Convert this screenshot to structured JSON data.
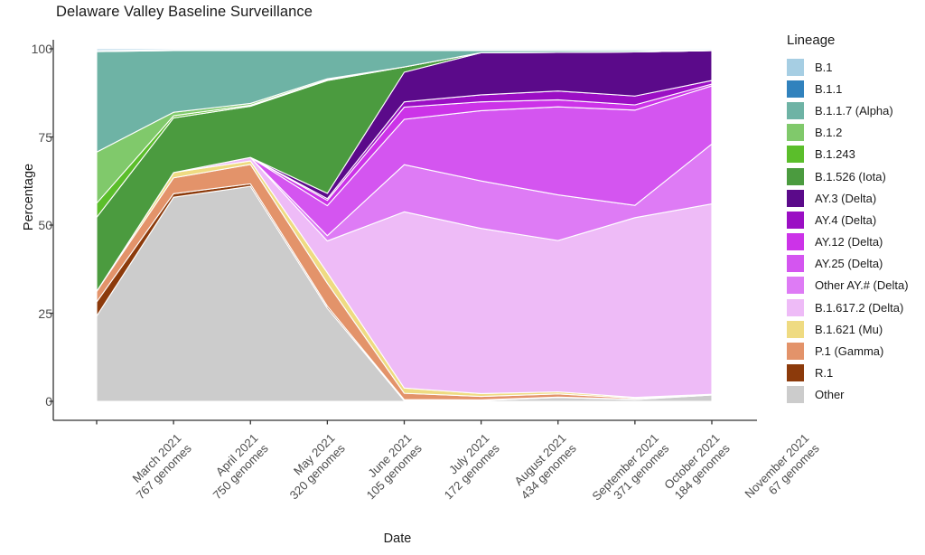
{
  "title": "Delaware Valley Baseline Surveillance",
  "axes": {
    "x_label": "Date",
    "y_label": "Percentage",
    "y_ticks": [
      "0",
      "25",
      "50",
      "75",
      "100"
    ]
  },
  "legend": {
    "title": "Lineage"
  },
  "chart_data": {
    "type": "area",
    "title": "Delaware Valley Baseline Surveillance",
    "subtitle": "",
    "xlabel": "Date",
    "ylabel": "Percentage",
    "stacked": true,
    "stack_order": "bottom-to-top matches legend reversed: Other, R.1, P.1 (Gamma), B.1.621 (Mu), B.1.617.2 (Delta), Other AY.# (Delta), AY.25 (Delta), AY.12 (Delta), AY.4 (Delta), AY.3 (Delta), B.1.526 (Iota), B.1.243, B.1.2, B.1.1.7 (Alpha), B.1.1, B.1",
    "grid": false,
    "legend_position": "right",
    "ylim": [
      0,
      100
    ],
    "yticks": [
      0,
      25,
      50,
      75,
      100
    ],
    "categories": [
      "March 2021\n767 genomes",
      "April 2021\n750 genomes",
      "May 2021\n320 genomes",
      "June 2021\n105 genomes",
      "July 2021\n172 genomes",
      "August 2021\n434 genomes",
      "September 2021\n371 genomes",
      "October 2021\n184 genomes",
      "November 2021\n67 genomes"
    ],
    "x_tick_labels": [
      {
        "date": "March 2021",
        "genomes": "767 genomes"
      },
      {
        "date": "April 2021",
        "genomes": "750 genomes"
      },
      {
        "date": "May 2021",
        "genomes": "320 genomes"
      },
      {
        "date": "June 2021",
        "genomes": "105 genomes"
      },
      {
        "date": "July 2021",
        "genomes": "172 genomes"
      },
      {
        "date": "August 2021",
        "genomes": "434 genomes"
      },
      {
        "date": "September 2021",
        "genomes": "371 genomes"
      },
      {
        "date": "October 2021",
        "genomes": "184 genomes"
      },
      {
        "date": "November 2021",
        "genomes": "67 genomes"
      }
    ],
    "series": [
      {
        "name": "B.1",
        "color": "#A6CEE3",
        "values": [
          0.5,
          0.3,
          0.3,
          0.3,
          0.3,
          0.3,
          0.3,
          0.3,
          0.3
        ]
      },
      {
        "name": "B.1.1",
        "color": "#3182BD",
        "values": [
          0.3,
          0.2,
          0.2,
          0.2,
          0.2,
          0.2,
          0.2,
          0.2,
          0.2
        ]
      },
      {
        "name": "B.1.1.7 (Alpha)",
        "color": "#6EB3A5",
        "values": [
          28.5,
          17.5,
          15.0,
          8.0,
          4.7,
          0.6,
          0.5,
          0.4,
          0.0
        ]
      },
      {
        "name": "B.1.2",
        "color": "#80C96B",
        "values": [
          14.5,
          1.0,
          0.5,
          0.3,
          0.0,
          0.0,
          0.0,
          0.0,
          0.0
        ]
      },
      {
        "name": "B.1.243",
        "color": "#5BBE2B",
        "values": [
          4.0,
          0.6,
          0.3,
          0.2,
          0.0,
          0.0,
          0.0,
          0.0,
          0.0
        ]
      },
      {
        "name": "B.1.526 (Iota)",
        "color": "#4B9B3F",
        "values": [
          21.0,
          15.5,
          14.5,
          32.0,
          1.5,
          0.0,
          0.0,
          0.0,
          0.0
        ]
      },
      {
        "name": "AY.3 (Delta)",
        "color": "#5B0A8A",
        "values": [
          0.0,
          0.0,
          0.0,
          1.5,
          8.5,
          12.0,
          11.0,
          12.5,
          8.5
        ]
      },
      {
        "name": "AY.4 (Delta)",
        "color": "#9B0FC4",
        "values": [
          0.0,
          0.0,
          0.0,
          0.5,
          1.5,
          2.0,
          2.5,
          2.5,
          1.0
        ]
      },
      {
        "name": "AY.12 (Delta)",
        "color": "#CC33E8",
        "values": [
          0.0,
          0.0,
          0.0,
          1.5,
          3.5,
          2.5,
          2.0,
          1.5,
          0.5
        ]
      },
      {
        "name": "AY.25 (Delta)",
        "color": "#D455F0",
        "values": [
          0.0,
          0.0,
          0.0,
          8.5,
          13.0,
          20.0,
          25.0,
          27.0,
          16.5
        ]
      },
      {
        "name": "Other AY.# (Delta)",
        "color": "#DE7BF5",
        "values": [
          0.0,
          0.0,
          0.0,
          1.5,
          13.5,
          13.5,
          13.0,
          3.5,
          17.0
        ]
      },
      {
        "name": "B.1.617.2 (Delta)",
        "color": "#EEBBF7",
        "values": [
          0.0,
          0.0,
          1.0,
          9.0,
          50.5,
          47.0,
          43.0,
          51.0,
          54.0
        ]
      },
      {
        "name": "B.1.621 (Mu)",
        "color": "#EFDB82",
        "values": [
          0.0,
          1.5,
          1.0,
          3.0,
          1.5,
          0.8,
          0.6,
          0.2,
          0.0
        ]
      },
      {
        "name": "P.1 (Gamma)",
        "color": "#E3936A",
        "values": [
          3.0,
          4.5,
          5.5,
          6.5,
          1.8,
          1.0,
          0.9,
          0.3,
          0.2
        ]
      },
      {
        "name": "R.1",
        "color": "#8C3A0B",
        "values": [
          4.0,
          1.0,
          0.7,
          0.6,
          0.3,
          0.2,
          0.1,
          0.1,
          0.0
        ]
      },
      {
        "name": "Other",
        "color": "#CCCCCC",
        "values": [
          24.2,
          57.9,
          61.0,
          26.4,
          0.2,
          0.2,
          1.1,
          0.5,
          1.8
        ]
      }
    ]
  }
}
